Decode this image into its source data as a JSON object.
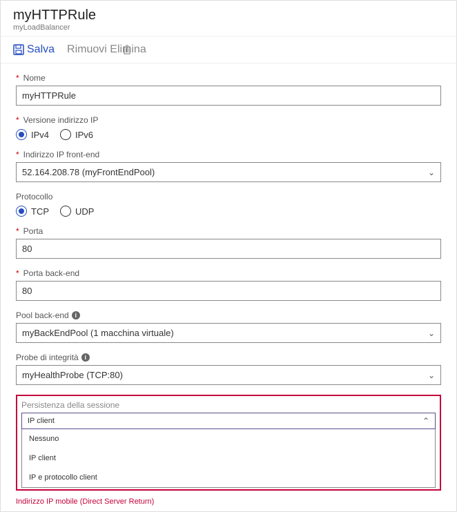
{
  "header": {
    "title": "myHTTPRule",
    "subtitle": "myLoadBalancer"
  },
  "toolbar": {
    "save": "Salva",
    "delete": "Rimuovi Elimina"
  },
  "form": {
    "name": {
      "label": "Nome",
      "value": "myHTTPRule"
    },
    "ipversion": {
      "label": "Versione indirizzo IP",
      "opt1": "IPv4",
      "opt2": "IPv6"
    },
    "frontend": {
      "label": "Indirizzo IP front-end",
      "value": "52.164.208.78 (myFrontEndPool)"
    },
    "protocol": {
      "label": "Protocollo",
      "opt1": "TCP",
      "opt2": "UDP"
    },
    "port": {
      "label": "Porta",
      "value": "80"
    },
    "backport": {
      "label": "Porta back-end",
      "value": "80"
    },
    "backpool": {
      "label": "Pool back-end",
      "value": "myBackEndPool (1 macchina virtuale)"
    },
    "probe": {
      "label": "Probe di integrità",
      "value": "myHealthProbe (TCP:80)"
    },
    "session": {
      "label": "Persistenza della sessione",
      "value": "IP client",
      "options": [
        "Nessuno",
        "IP client",
        "IP e protocollo client"
      ]
    },
    "floating": "Indirizzo IP mobile (Direct Server Return)"
  }
}
